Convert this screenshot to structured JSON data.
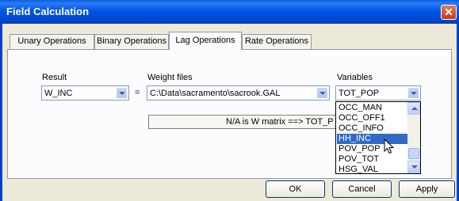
{
  "window": {
    "title": "Field Calculation"
  },
  "tabs": [
    "Unary Operations",
    "Binary Operations",
    "Lag Operations",
    "Rate Operations"
  ],
  "active_tab": "Lag Operations",
  "form": {
    "result_label": "Result",
    "result_value": "W_INC",
    "equals": "=",
    "weight_label": "Weight files",
    "weight_value": "C:\\Data\\sacramento\\sacrook.GAL",
    "variables_label": "Variables",
    "variables_value": "TOT_POP",
    "message": "N/A is W matrix ==> TOT_P"
  },
  "variables_list": {
    "items": [
      "OCC_MAN",
      "OCC_OFF1",
      "OCC_INFO",
      "HH_INC",
      "POV_POP",
      "POV_TOT",
      "HSG_VAL"
    ],
    "selected": "HH_INC"
  },
  "buttons": {
    "ok": "OK",
    "cancel": "Cancel",
    "apply": "Apply"
  },
  "colors": {
    "titlebar": "#0055e5",
    "selection": "#316ac5",
    "close": "#c63d1c"
  }
}
